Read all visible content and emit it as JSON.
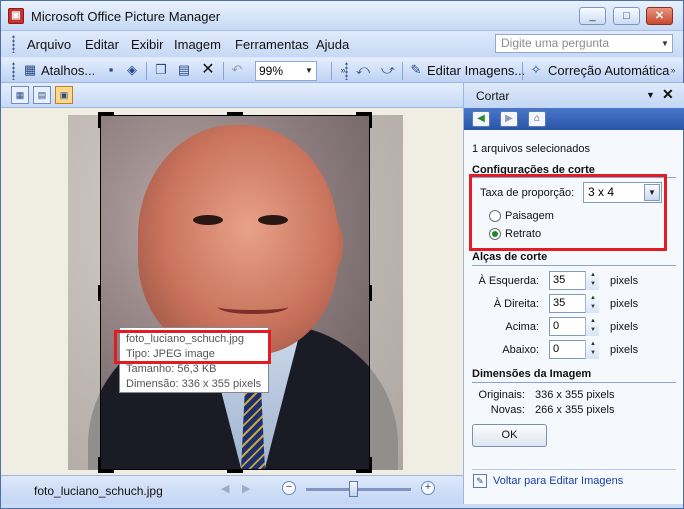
{
  "window": {
    "title": "Microsoft Office Picture Manager",
    "controls": {
      "minimize": "_",
      "maximize": "□",
      "close": "✕"
    }
  },
  "menu": {
    "items": [
      "Arquivo",
      "Editar",
      "Exibir",
      "Imagem",
      "Ferramentas",
      "Ajuda"
    ],
    "help_placeholder": "Digite uma pergunta"
  },
  "toolbar": {
    "shortcuts_label": "Atalhos...",
    "zoom_value": "99%",
    "edit_images_label": "Editar Imagens...",
    "auto_correct_label": "Correção Automática"
  },
  "canvas": {
    "tooltip": {
      "filename": "foto_luciano_schuch.jpg",
      "type": "Tipo: JPEG image",
      "size": "Tamanho: 56,3 KB",
      "dimension": "Dimensão: 336 x 355 pixels"
    }
  },
  "status": {
    "filename": "foto_luciano_schuch.jpg",
    "zoom_slider_fraction": 0.45
  },
  "pane": {
    "title": "Cortar",
    "selected_count": "1 arquivos selecionados",
    "crop_settings_title": "Configurações de corte",
    "ratio_label": "Taxa de proporção:",
    "ratio_value": "3 x 4",
    "orientation": {
      "landscape": "Paisagem",
      "portrait": "Retrato",
      "selected": "portrait"
    },
    "handles_title": "Alças de corte",
    "handles": [
      {
        "label": "À Esquerda:",
        "value": "35",
        "unit": "pixels"
      },
      {
        "label": "À Direita:",
        "value": "35",
        "unit": "pixels"
      },
      {
        "label": "Acima:",
        "value": "0",
        "unit": "pixels"
      },
      {
        "label": "Abaixo:",
        "value": "0",
        "unit": "pixels"
      }
    ],
    "dimensions_title": "Dimensões da Imagem",
    "original_label": "Originais:",
    "original_value": "336 x 355 pixels",
    "new_label": "Novas:",
    "new_value": "266 x 355 pixels",
    "ok_label": "OK",
    "back_link": "Voltar para Editar Imagens"
  }
}
